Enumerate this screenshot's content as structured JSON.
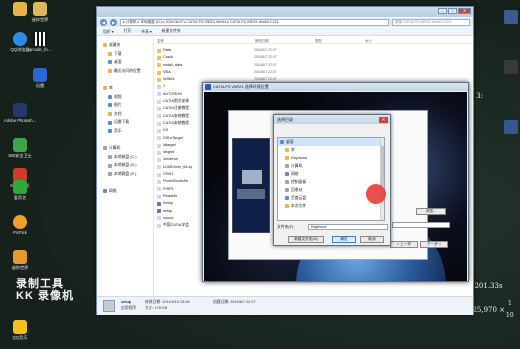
{
  "desktop": {
    "icons": [
      {
        "label": "",
        "icon": "folder-icon",
        "color": "#e3b64a"
      },
      {
        "label": "迷你世界",
        "icon": "app-icon",
        "color": "#d9b95a"
      },
      {
        "label": "QQ浏览器",
        "icon": "browser-icon",
        "color": "#2b8de0"
      },
      {
        "label": "qrcode_fo...",
        "icon": "qrcode-icon",
        "color": "#f2f2f2"
      },
      {
        "label": "迅雷",
        "icon": "thunder-icon",
        "color": "#2a67d4"
      },
      {
        "label": "Adobe Photosh...",
        "icon": "photoshop-icon",
        "color": "#24386a"
      },
      {
        "label": "360安全卫士",
        "icon": "shield-icon",
        "color": "#3fa34d"
      },
      {
        "label": "KK 录像机",
        "icon": "recorder-icon",
        "color": "#d0392e"
      },
      {
        "label": "爱奇艺",
        "icon": "iqiyi-icon",
        "color": "#2faa3a"
      },
      {
        "label": "PicPick",
        "icon": "picpick-icon",
        "color": "#f0a02a"
      },
      {
        "label": "迷你世界",
        "icon": "game-icon",
        "color": "#e29a31"
      },
      {
        "label": "QQ音乐",
        "icon": "music-icon",
        "color": "#f1c21b"
      }
    ],
    "watermark": {
      "line1": "录制工具",
      "line2": "KK 录像机"
    },
    "board": {
      "top": "x 3:",
      "mid": "5201.33s",
      "bot": "525,970 ×",
      "frac1": "1",
      "frac2": "10"
    }
  },
  "explorer": {
    "address": "▸ 计算机 ▸ 本地磁盘 (D:) ▸ 2016.06.07 ▸ CATIA.P3.V5R21.Win64 ▸ CATIA.P3.V5R21.Win64.CZ21",
    "search_placeholder": "搜索 CATIA.P3.V5R21.Win64.CZ21",
    "toolbar": [
      "组织 ▾",
      "打开",
      "共享 ▾",
      "新建文件夹"
    ],
    "columns": [
      "名称",
      "修改日期",
      "类型",
      "大小"
    ],
    "nav": [
      {
        "label": "收藏夹",
        "level": "g1",
        "icon": "star"
      },
      {
        "label": "下载",
        "level": "g2",
        "icon": "folder"
      },
      {
        "label": "桌面",
        "level": "g2",
        "icon": "blue"
      },
      {
        "label": "最近访问的位置",
        "level": "g2",
        "icon": "folder"
      },
      {
        "label": "",
        "level": "g1",
        "icon": "none"
      },
      {
        "label": "库",
        "level": "g1",
        "icon": "folder"
      },
      {
        "label": "视频",
        "level": "g2",
        "icon": "blue"
      },
      {
        "label": "图片",
        "level": "g2",
        "icon": "blue"
      },
      {
        "label": "文档",
        "level": "g2",
        "icon": "folder"
      },
      {
        "label": "迅雷下载",
        "level": "g2",
        "icon": "blue"
      },
      {
        "label": "音乐",
        "level": "g2",
        "icon": "blue"
      },
      {
        "label": "",
        "level": "g1",
        "icon": "none"
      },
      {
        "label": "计算机",
        "level": "g1",
        "icon": "gray"
      },
      {
        "label": "本地磁盘 (C:)",
        "level": "g2",
        "icon": "gray"
      },
      {
        "label": "本地磁盘 (D:)",
        "level": "g2",
        "icon": "gray"
      },
      {
        "label": "本地磁盘 (E:)",
        "level": "g2",
        "icon": "gray"
      },
      {
        "label": "",
        "level": "g1",
        "icon": "none"
      },
      {
        "label": "网络",
        "level": "g1",
        "icon": "blue"
      }
    ],
    "files": [
      {
        "name": "Data",
        "date": "2016/6/7 22:07",
        "kind": "folder"
      },
      {
        "name": "Crack",
        "date": "2016/6/7 22:07",
        "kind": "folder"
      },
      {
        "name": "install_data",
        "date": "2016/6/7 22:07",
        "kind": "folder"
      },
      {
        "name": "VBA",
        "date": "2016/6/7 22:07",
        "kind": "folder"
      },
      {
        "name": "WIN64",
        "date": "2016/6/7 22:07",
        "kind": "folder"
      },
      {
        "name": "1",
        "date": "",
        "kind": "doc"
      },
      {
        "name": "AUTORUN",
        "date": "",
        "kind": "doc"
      },
      {
        "name": "CATIA图文安装",
        "date": "",
        "kind": "doc"
      },
      {
        "name": "CATIA注册教程",
        "date": "",
        "kind": "doc"
      },
      {
        "name": "CATIA安装教程",
        "date": "",
        "kind": "doc"
      },
      {
        "name": "CATIA安装教程",
        "date": "",
        "kind": "doc"
      },
      {
        "name": "DS",
        "date": "",
        "kind": "doc"
      },
      {
        "name": "DSLsTarget",
        "date": "",
        "kind": "doc"
      },
      {
        "name": "idtarget",
        "date": "",
        "kind": "doc"
      },
      {
        "name": "idxgrid",
        "date": "",
        "kind": "doc"
      },
      {
        "name": "lumdevel",
        "date": "",
        "kind": "doc"
      },
      {
        "name": "LUMDriver_64.sy",
        "date": "",
        "kind": "doc"
      },
      {
        "name": "OSNT",
        "date": "",
        "kind": "doc"
      },
      {
        "name": "PhotoStudioSe",
        "date": "",
        "kind": "doc"
      },
      {
        "name": "PISP1",
        "date": "",
        "kind": "doc"
      },
      {
        "name": "ReadMe",
        "date": "",
        "kind": "doc"
      },
      {
        "name": "Setup",
        "date": "",
        "kind": "exe"
      },
      {
        "name": "setup",
        "date": "",
        "kind": "exe"
      },
      {
        "name": "sound",
        "date": "",
        "kind": "doc"
      },
      {
        "name": "中国CATIA学会",
        "date": "",
        "kind": "doc"
      }
    ],
    "details": {
      "name": "setup",
      "modified": "修改日期: 2011/4/13 13:06",
      "created": "创建日期: 2016/6/7 22:07",
      "type": "应用程序",
      "size": "大小: 178 KB"
    }
  },
  "catia_dialog": {
    "title": "CATIA P3 V5R21 选择环境位置",
    "buttons": {
      "browse": "浏览...",
      "back": "< 上一步",
      "next": "下一步 >"
    }
  },
  "select_dialog": {
    "title": "选择目录",
    "close": "✕",
    "tree": [
      {
        "label": "桌面",
        "level": "l0",
        "icon": "blue",
        "selected": true
      },
      {
        "label": "库",
        "level": "l1",
        "icon": "folder"
      },
      {
        "label": "Raymond",
        "level": "l1",
        "icon": "folder"
      },
      {
        "label": "计算机",
        "level": "l1",
        "icon": "gray"
      },
      {
        "label": "网络",
        "level": "l1",
        "icon": "blue"
      },
      {
        "label": "控制面板",
        "level": "l1",
        "icon": "gray"
      },
      {
        "label": "回收站",
        "level": "l1",
        "icon": "gray"
      },
      {
        "label": "百度云盘",
        "level": "l1",
        "icon": "blue"
      },
      {
        "label": "本次文件",
        "level": "l1",
        "icon": "folder"
      },
      {
        "label": "",
        "level": "l1",
        "icon": "none"
      }
    ],
    "folder_label": "文件夹(F):",
    "folder_value": "Raymond",
    "buttons": {
      "new_folder": "新建文件夹(M)",
      "ok": "确定",
      "cancel": "取消"
    }
  }
}
